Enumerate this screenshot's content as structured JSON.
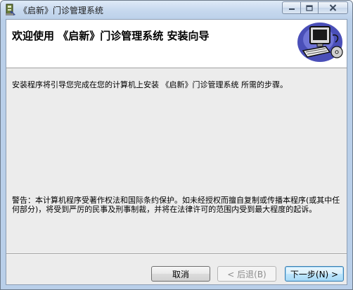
{
  "window": {
    "title": "《启新》门诊管理系统"
  },
  "caption_buttons": {
    "minimize_icon": "minimize-icon",
    "maximize_icon": "maximize-icon",
    "close_icon": "close-icon"
  },
  "banner": {
    "title": "欢迎使用 《启新》门诊管理系统 安装向导",
    "art_icon": "computer-setup-icon"
  },
  "content": {
    "intro": "安装程序将引导您完成在您的计算机上安装 《启新》门诊管理系统 所需的步骤。",
    "warning": "警告：本计算机程序受著作权法和国际条约保护。如未经授权而擅自复制或传播本程序(或其中任何部分)，将受到严厉的民事及刑事制裁，并将在法律许可的范围内受到最大程度的起诉。"
  },
  "buttons": {
    "cancel": "取消",
    "back": "< 后退(B)",
    "next": "下一步(N) >"
  },
  "colors": {
    "titlebar": "#c6d8ee",
    "client_background": "#ececec",
    "banner_background": "#ffffff",
    "default_button_border": "#3c7fb1"
  }
}
